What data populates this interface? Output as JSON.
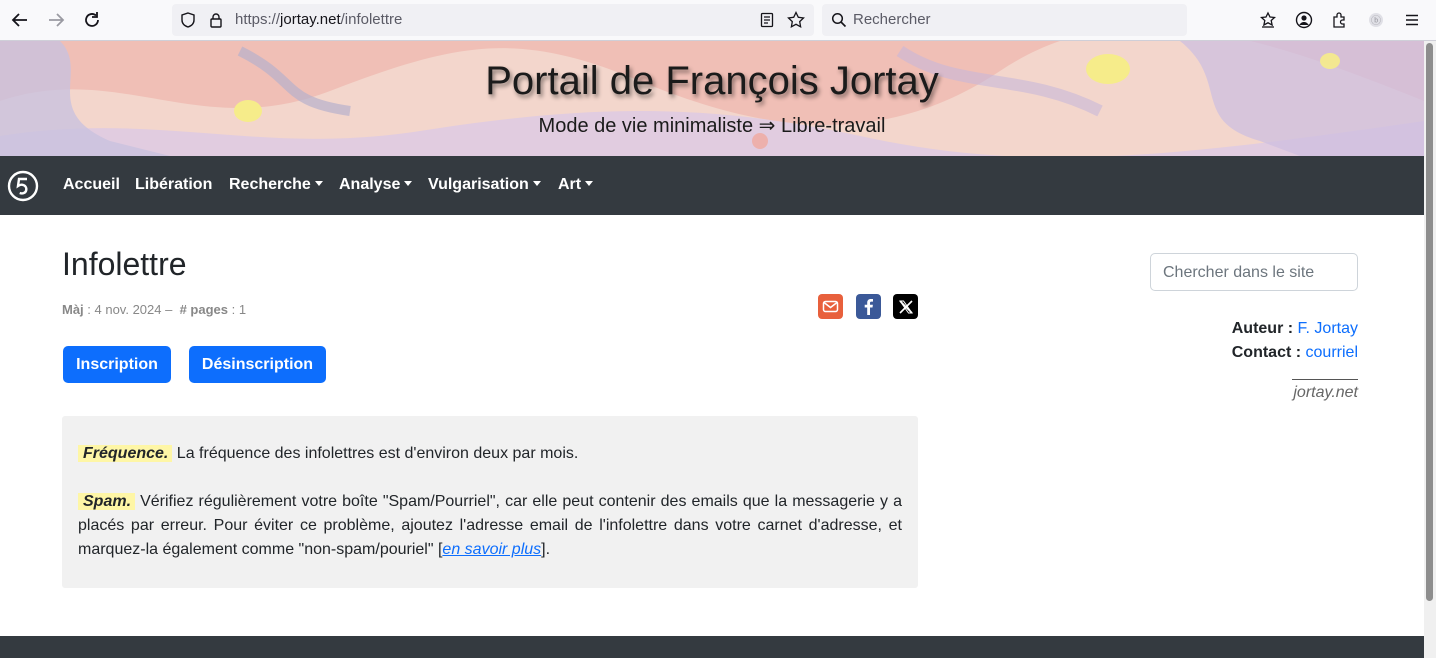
{
  "browser": {
    "url_prefix": "https://",
    "url_domain": "jortay.net",
    "url_path": "/infolettre",
    "search_placeholder": "Rechercher"
  },
  "banner": {
    "title": "Portail de François Jortay",
    "subtitle": "Mode de vie minimaliste ⇒ Libre-travail"
  },
  "nav": {
    "items": [
      {
        "label": "Accueil",
        "dropdown": false
      },
      {
        "label": "Libération",
        "dropdown": false
      },
      {
        "label": "Recherche",
        "dropdown": true
      },
      {
        "label": "Analyse",
        "dropdown": true
      },
      {
        "label": "Vulgarisation",
        "dropdown": true
      },
      {
        "label": "Art",
        "dropdown": true
      }
    ]
  },
  "page": {
    "title": "Infolettre",
    "meta_update_label": "Màj",
    "meta_update_value": " : 4 nov. 2024",
    "meta_sep": " – ",
    "meta_pages_label": "# pages",
    "meta_pages_value": " : 1",
    "buttons": {
      "subscribe": "Inscription",
      "unsubscribe": "Désinscription"
    },
    "info": {
      "freq_label": "Fréquence.",
      "freq_text": " La fréquence des infolettres est d'environ deux par mois.",
      "spam_label": "Spam.",
      "spam_text": " Vérifiez régulièrement votre boîte \"Spam/Pourriel\", car elle peut contenir des emails que la messagerie y a placés par erreur. Pour éviter ce problème, ajoutez l'adresse email de l'infolettre dans votre carnet d'adresse, et marquez-la également comme \"non-spam/pouriel\" [",
      "spam_link": "en savoir plus",
      "spam_end": "]."
    }
  },
  "sidebar": {
    "search_placeholder": "Chercher dans le site",
    "author_label": "Auteur :",
    "author_value": "F. Jortay",
    "contact_label": "Contact :",
    "contact_value": "courriel",
    "domain": "jortay.net"
  },
  "icons": [
    "back-icon",
    "forward-icon",
    "reload-icon",
    "shield-icon",
    "lock-icon",
    "reader-icon",
    "star-icon",
    "search-icon",
    "extensions-icon",
    "account-icon",
    "puzzle-icon",
    "menu-icon",
    "site-logo-icon",
    "email-share-icon",
    "facebook-icon",
    "x-icon"
  ],
  "colors": {
    "accent": "#0d6efd",
    "navbar": "#343a40",
    "highlight": "#fef6a6"
  }
}
